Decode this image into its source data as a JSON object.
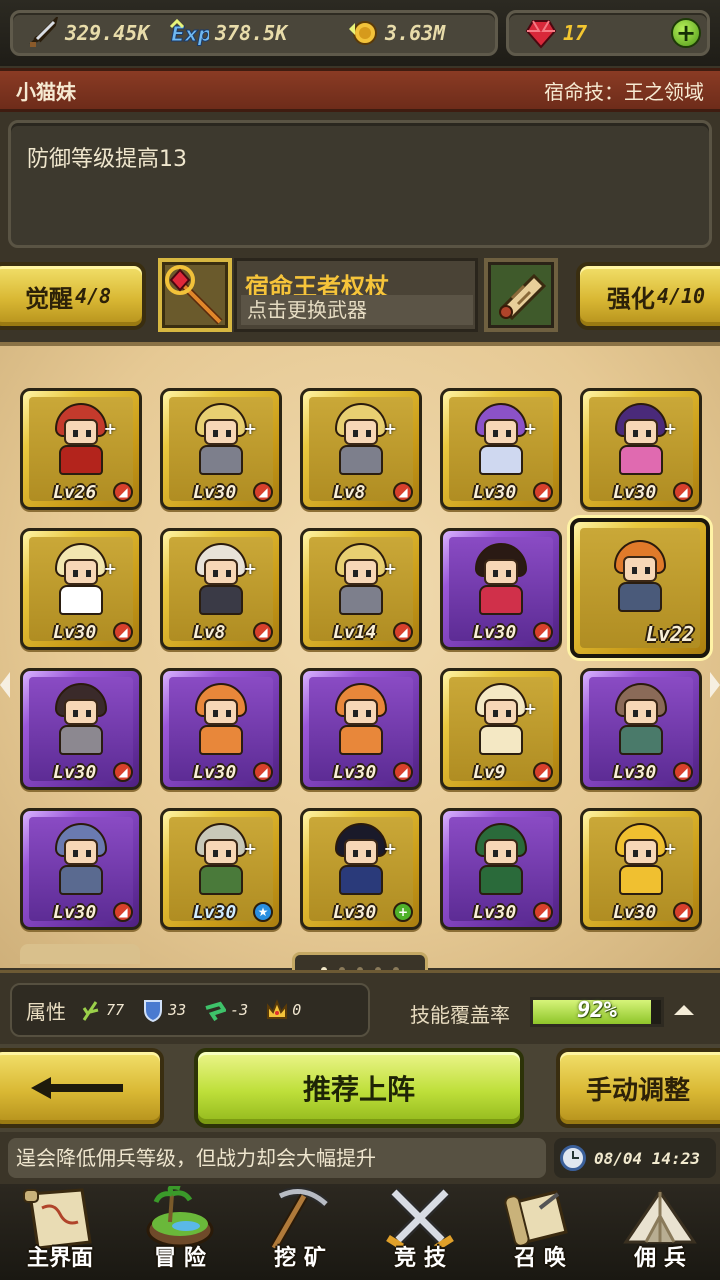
{
  "resources": {
    "power": "329.45K",
    "exp": "378.5K",
    "gold": "3.63M",
    "gems": "17"
  },
  "hero": {
    "name": "小猫妹",
    "fate_skill": "宿命技：王之领域",
    "description": "防御等级提高13"
  },
  "weapon_row": {
    "awaken_label": "觉醒",
    "awaken_progress": "4/8",
    "weapon_name": "宿命王者权杖",
    "weapon_hint": "点击更换武器",
    "enhance_label": "强化",
    "enhance_progress": "4/10"
  },
  "hero_cards": [
    {
      "rarity": "gold",
      "level": "Lv26",
      "badge": "red",
      "hair": "#c43a2c",
      "outfit": "#b3241c"
    },
    {
      "rarity": "gold",
      "level": "Lv30",
      "badge": "red",
      "hair": "#e8cf72",
      "outfit": "#7d7f8c"
    },
    {
      "rarity": "gold",
      "level": "Lv8",
      "badge": "red",
      "hair": "#e8cf72",
      "outfit": "#7d7f8c"
    },
    {
      "rarity": "gold",
      "level": "Lv30",
      "badge": "red",
      "hair": "#8b52c8",
      "outfit": "#cfd8f0"
    },
    {
      "rarity": "gold",
      "level": "Lv30",
      "badge": "red",
      "hair": "#4a2a7a",
      "outfit": "#e06ab0"
    },
    {
      "rarity": "gold",
      "level": "Lv30",
      "badge": "red",
      "hair": "#f2e6b0",
      "outfit": "#ffffff"
    },
    {
      "rarity": "gold",
      "level": "Lv8",
      "badge": "red",
      "hair": "#e8e2d8",
      "outfit": "#3a3a46"
    },
    {
      "rarity": "gold",
      "level": "Lv14",
      "badge": "red",
      "hair": "#e8cf72",
      "outfit": "#7d7f8c"
    },
    {
      "rarity": "purple",
      "level": "Lv30",
      "badge": "red",
      "hair": "#2a1a14",
      "outfit": "#d0304a"
    },
    {
      "rarity": "gold",
      "level": "Lv22",
      "badge": "",
      "hair": "#e07a2a",
      "outfit": "#4a5a7a",
      "selected": true
    },
    {
      "rarity": "purple",
      "level": "Lv30",
      "badge": "red",
      "hair": "#3a2a2a",
      "outfit": "#8c8890"
    },
    {
      "rarity": "purple",
      "level": "Lv30",
      "badge": "red",
      "hair": "#e8873a",
      "outfit": "#e8873a"
    },
    {
      "rarity": "purple",
      "level": "Lv30",
      "badge": "red",
      "hair": "#e8873a",
      "outfit": "#e8873a"
    },
    {
      "rarity": "gold",
      "level": "Lv9",
      "badge": "red",
      "hair": "#f4e8c4",
      "outfit": "#f4e8c4"
    },
    {
      "rarity": "purple",
      "level": "Lv30",
      "badge": "red",
      "hair": "#8a6a58",
      "outfit": "#4a7a6a"
    },
    {
      "rarity": "purple",
      "level": "Lv30",
      "badge": "red",
      "hair": "#6a7ab0",
      "outfit": "#5a6a90"
    },
    {
      "rarity": "gold",
      "level": "Lv30",
      "badge": "blue",
      "hair": "#c8c8b8",
      "outfit": "#4a7a3a"
    },
    {
      "rarity": "gold",
      "level": "Lv30",
      "badge": "green",
      "hair": "#1a1a2a",
      "outfit": "#2a3a7a"
    },
    {
      "rarity": "purple",
      "level": "Lv30",
      "badge": "red",
      "hair": "#2a6a3a",
      "outfit": "#2a6a3a"
    },
    {
      "rarity": "gold",
      "level": "Lv30",
      "badge": "red",
      "hair": "#f0c030",
      "outfit": "#f0c030"
    }
  ],
  "pager": {
    "pages": 5,
    "current": 1
  },
  "attributes": {
    "label": "属性",
    "nature": "77",
    "shield": "33",
    "wind": "-3",
    "crown": "0"
  },
  "coverage": {
    "label": "技能覆盖率",
    "value_text": "92%",
    "fraction": 0.92
  },
  "actions": {
    "recommend_label": "推荐上阵",
    "manual_label": "手动调整"
  },
  "tip": {
    "text": "逞会降低佣兵等级，但战力却会大幅提升",
    "time": "08/04 14:23"
  },
  "nav": [
    {
      "label": "主界面",
      "icon": "map-scroll-icon"
    },
    {
      "label": "冒 险",
      "icon": "island-icon"
    },
    {
      "label": "挖 矿",
      "icon": "pickaxe-icon"
    },
    {
      "label": "竞 技",
      "icon": "crossed-swords-icon"
    },
    {
      "label": "召 唤",
      "icon": "summon-scroll-icon"
    },
    {
      "label": "佣 兵",
      "icon": "tent-icon"
    }
  ],
  "colors": {
    "gold_card": "#e9c83f",
    "purple_card": "#9a57d8",
    "header_red": "#8a3b24",
    "weapon_name": "#f6c43a",
    "coverage_fill": "#8fc52a"
  }
}
